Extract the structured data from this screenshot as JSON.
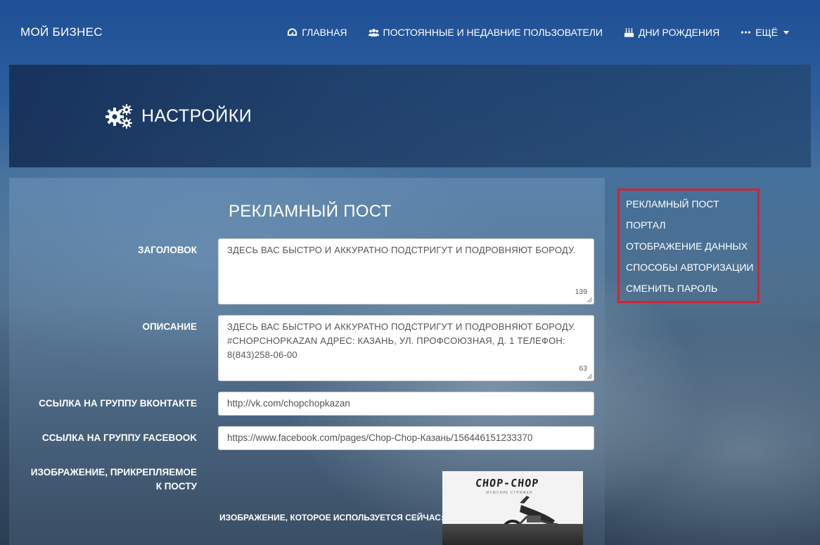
{
  "navbar": {
    "brand": "МОЙ БИЗНЕС",
    "items": [
      {
        "label": "ГЛАВНАЯ",
        "icon": "dashboard-icon"
      },
      {
        "label": "ПОСТОЯННЫЕ И НЕДАВНИЕ ПОЛЬЗОВАТЕЛИ",
        "icon": "users-icon"
      },
      {
        "label": "ДНИ РОЖДЕНИЯ",
        "icon": "birthday-cake-icon"
      },
      {
        "label": "ЕЩЁ",
        "icon": "ellipsis-icon"
      }
    ]
  },
  "header": {
    "title": "НАСТРОЙКИ",
    "icon": "gears-icon"
  },
  "form": {
    "section_title": "РЕКЛАМНЫЙ ПОСТ",
    "title_label": "ЗАГОЛОВОК",
    "title_value": "ЗДЕСЬ ВАС БЫСТРО И АККУРАТНО ПОДСТРИГУТ И ПОДРОВНЯЮТ БОРОДУ.",
    "title_counter": "139",
    "description_label": "ОПИСАНИЕ",
    "description_value": "ЗДЕСЬ ВАС БЫСТРО И АККУРАТНО ПОДСТРИГУТ И ПОДРОВНЯЮТ БОРОДУ. #CHOPCHOPKAZAN АДРЕС: КАЗАНЬ, УЛ. ПРОФСОЮЗНАЯ, Д. 1 ТЕЛЕФОН: 8(843)258-06-00",
    "description_counter": "63",
    "vk_label": "ССЫЛКА НА ГРУППУ ВКОНТАКТЕ",
    "vk_value": "http://vk.com/chopchopkazan",
    "facebook_label": "ССЫЛКА НА ГРУППУ FACEBOOK",
    "facebook_value": "https://www.facebook.com/pages/Chop-Chop-Казань/156446151233370",
    "image_label_line1": "ИЗОБРАЖЕНИЕ, ПРИКРЕПЛЯЕМОЕ",
    "image_label_line2": "К ПОСТУ",
    "current_image_label": "ИЗОБРАЖЕНИЕ, КОТОРОЕ ИСПОЛЬЗУЕТСЯ СЕЙЧАС:",
    "image_logo_text": "CHOP-CHOP",
    "image_logo_subtext": "МУЖСКИЕ СТРИЖКИ"
  },
  "side_menu": {
    "border_color": "#d42331",
    "items": [
      "РЕКЛАМНЫЙ ПОСТ",
      "ПОРТАЛ",
      "ОТОБРАЖЕНИЕ ДАННЫХ",
      "СПОСОБЫ АВТОРИЗАЦИИ",
      "СМЕНИТЬ ПАРОЛЬ"
    ]
  }
}
